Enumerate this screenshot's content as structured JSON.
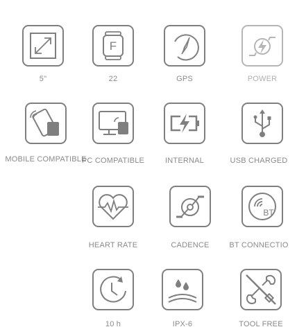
{
  "icons": [
    {
      "name": "screen-size",
      "icon": "diagonal-resize-arrow-icon",
      "label": "5\""
    },
    {
      "name": "watch",
      "icon": "watch-f-icon",
      "label": "22"
    },
    {
      "name": "gps",
      "icon": "compass-icon",
      "label": "GPS"
    },
    {
      "name": "power",
      "icon": "power-generator-icon",
      "label": "POWER"
    },
    {
      "name": "mobile-compatible",
      "icon": "phone-wireless-icon",
      "label": "MOBILE COMPATIBLE"
    },
    {
      "name": "pc-compatible",
      "icon": "monitor-wireless-icon",
      "label": "PC COMPATIBLE"
    },
    {
      "name": "internal-battery",
      "icon": "battery-charging-icon",
      "label": "INTERNAL"
    },
    {
      "name": "usb-charged",
      "icon": "usb-icon",
      "label": "USB CHARGED"
    },
    {
      "name": "heart-rate",
      "icon": "heart-pulse-icon",
      "label": "HEART RATE"
    },
    {
      "name": "cadence",
      "icon": "cadence-sensor-icon",
      "label": "CADENCE"
    },
    {
      "name": "bt-connection",
      "icon": "bluetooth-signal-icon",
      "label": "BT CONNECTIO"
    },
    {
      "name": "battery-life",
      "icon": "clock-refresh-icon",
      "label": "10 h"
    },
    {
      "name": "waterproof",
      "icon": "water-drops-icon",
      "label": "IPX-6"
    },
    {
      "name": "tool-free",
      "icon": "no-tools-icon",
      "label": "TOOL FREE"
    }
  ],
  "colors": {
    "stroke": "#7f7f7f",
    "stroke_light": "#b5b5b5",
    "text": "#8a8a8a"
  }
}
